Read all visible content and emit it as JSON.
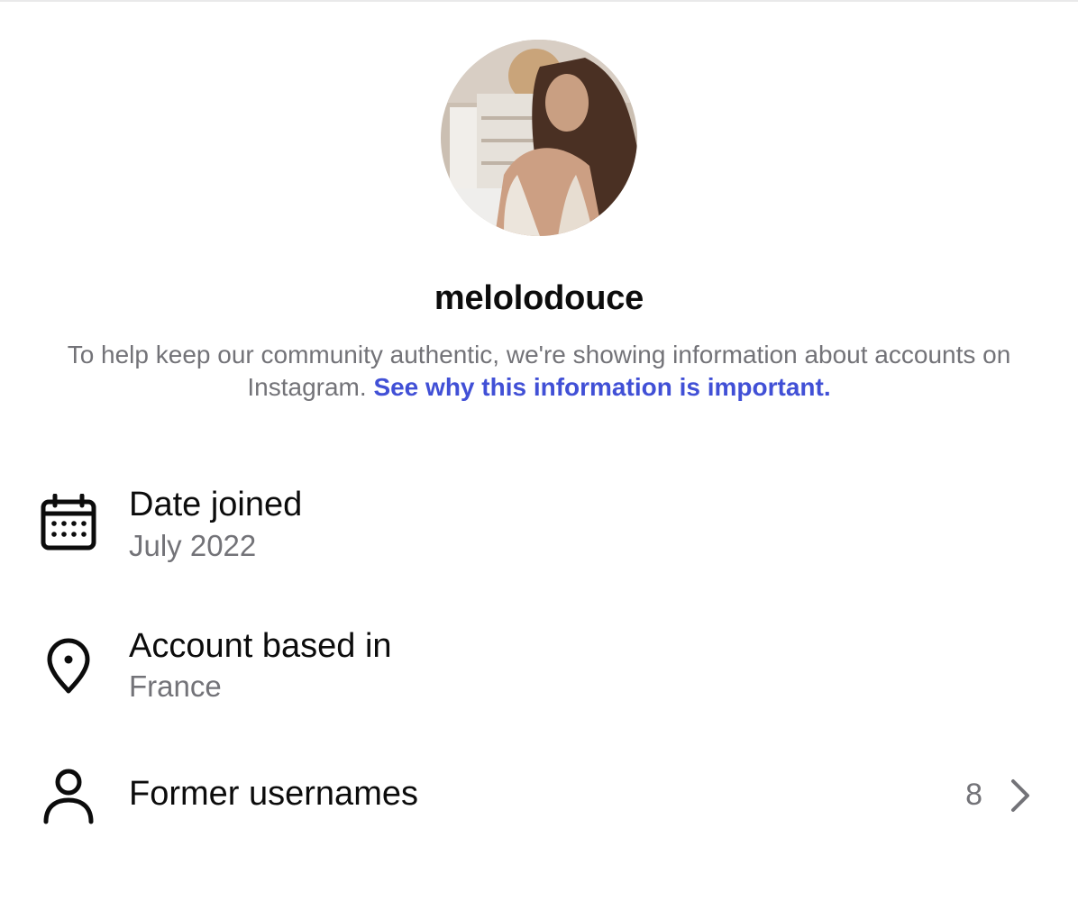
{
  "profile": {
    "username": "melolodouce",
    "avatar_icon": "profile-photo"
  },
  "notice": {
    "text": "To help keep our community authentic, we're showing information about accounts on Instagram.",
    "link_label": "See why this information is important."
  },
  "rows": {
    "date_joined": {
      "icon": "calendar-icon",
      "title": "Date joined",
      "value": "July 2022"
    },
    "location": {
      "icon": "location-pin-icon",
      "title": "Account based in",
      "value": "France"
    },
    "former_usernames": {
      "icon": "person-icon",
      "title": "Former usernames",
      "count": "8",
      "chevron_icon": "chevron-right-icon"
    }
  },
  "colors": {
    "text_primary": "#0c0c0c",
    "text_secondary": "#737378",
    "link": "#4150d6",
    "background": "#ffffff"
  }
}
